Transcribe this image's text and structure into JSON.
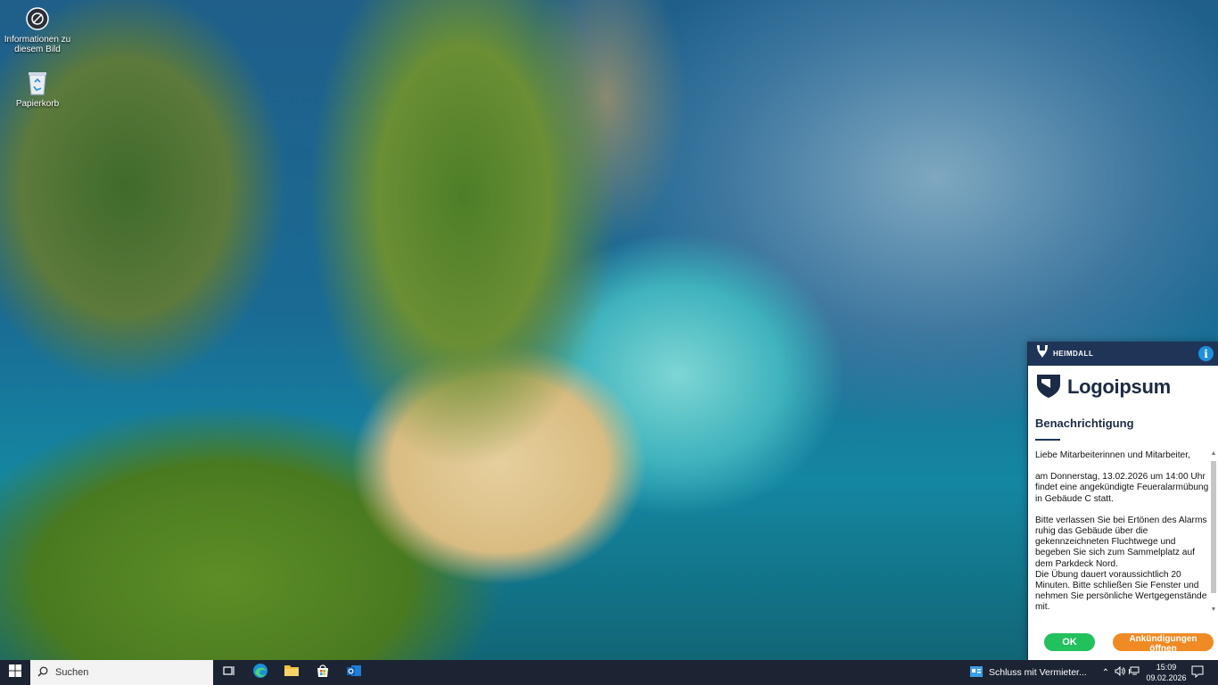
{
  "desktop": {
    "icons": [
      {
        "label": "Informationen zu diesem Bild",
        "icon": "camera-info-icon"
      },
      {
        "label": "Papierkorb",
        "icon": "recycle-bin-icon"
      }
    ]
  },
  "notification": {
    "brand": "HEIMDALL",
    "logo_text": "Logoipsum",
    "title": "Benachrichtigung",
    "greeting": "Liebe Mitarbeiterinnen und Mitarbeiter,",
    "paragraph1": "am Donnerstag, 13.02.2026 um 14:00 Uhr findet eine angekündigte Feueralarmübung in Gebäude C statt.",
    "paragraph2": "Bitte verlassen Sie bei Ertönen des Alarms ruhig das Gebäude über die gekennzeichneten Fluchtwege und begeben Sie sich zum Sammelplatz auf dem Parkdeck Nord.",
    "paragraph3": "Die Übung dauert voraussichtlich 20 Minuten. Bitte schließen Sie Fenster und nehmen Sie persönliche Wertgegenstände mit.",
    "ok_label": "OK",
    "open_label": "Ankündigungen öffnen",
    "colors": {
      "header": "#1f3557",
      "ok": "#22c15e",
      "open": "#f08a24",
      "info": "#1e90d8"
    }
  },
  "taskbar": {
    "search_placeholder": "Suchen",
    "notification_app_label": "Schluss mit Vermieter...",
    "time": "15:09",
    "date": "09.02.2026"
  }
}
